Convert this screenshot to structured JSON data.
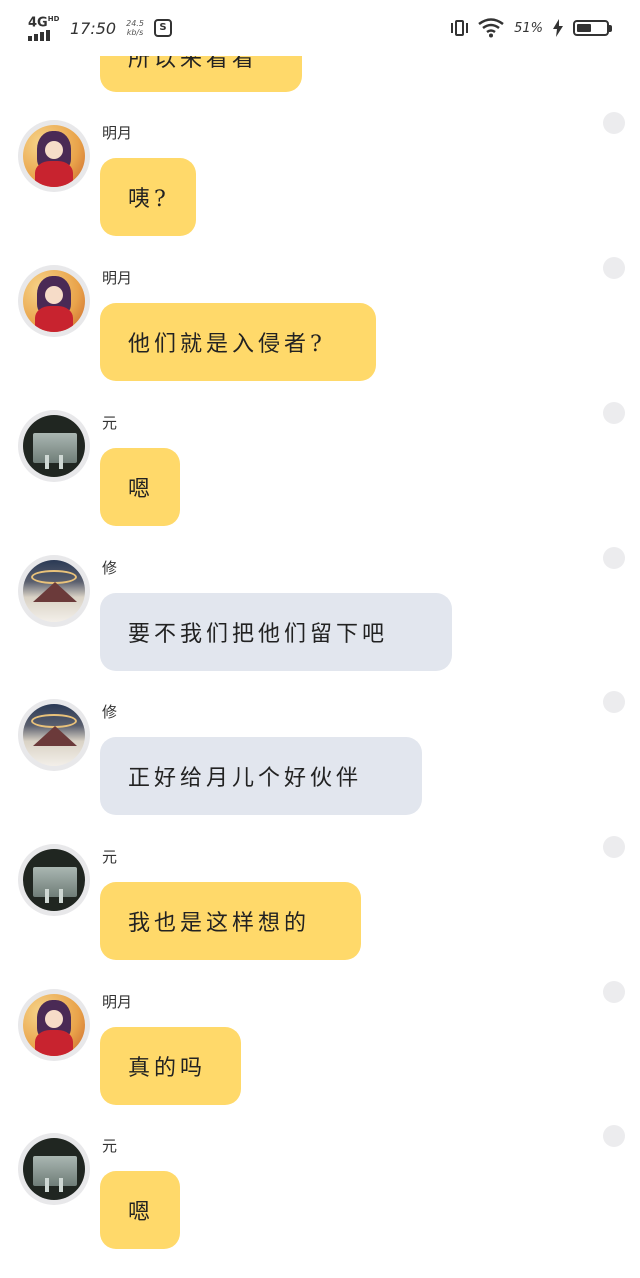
{
  "status_bar": {
    "network": "4G",
    "network_hd": "HD",
    "time": "17:50",
    "speed_value": "24.5",
    "speed_unit": "kb/s",
    "app_icon": "S",
    "battery_percent": "51%",
    "battery_level": 0.51,
    "icons": [
      "signal-icon",
      "vibrate-icon",
      "wifi-icon",
      "charging-icon",
      "battery-icon"
    ]
  },
  "colors": {
    "bubble_yellow": "#ffd96a",
    "bubble_gray": "#e2e6ee",
    "avatar_ring": "#e8e8ea",
    "side_dot": "#ececee"
  },
  "chat": {
    "partial_top_message": "所以来看看",
    "messages": [
      {
        "sender": "明月",
        "avatar": "mingyue",
        "bubble": "yellow",
        "text": "咦?"
      },
      {
        "sender": "明月",
        "avatar": "mingyue",
        "bubble": "yellow",
        "text": "他们就是入侵者?"
      },
      {
        "sender": "元",
        "avatar": "yuan",
        "bubble": "yellow",
        "text": "嗯"
      },
      {
        "sender": "修",
        "avatar": "xiu",
        "bubble": "gray",
        "text": "要不我们把他们留下吧"
      },
      {
        "sender": "修",
        "avatar": "xiu",
        "bubble": "gray",
        "text": "正好给月儿个好伙伴"
      },
      {
        "sender": "元",
        "avatar": "yuan",
        "bubble": "yellow",
        "text": "我也是这样想的"
      },
      {
        "sender": "明月",
        "avatar": "mingyue",
        "bubble": "yellow",
        "text": "真的吗"
      },
      {
        "sender": "元",
        "avatar": "yuan",
        "bubble": "yellow",
        "text": "嗯"
      }
    ]
  }
}
